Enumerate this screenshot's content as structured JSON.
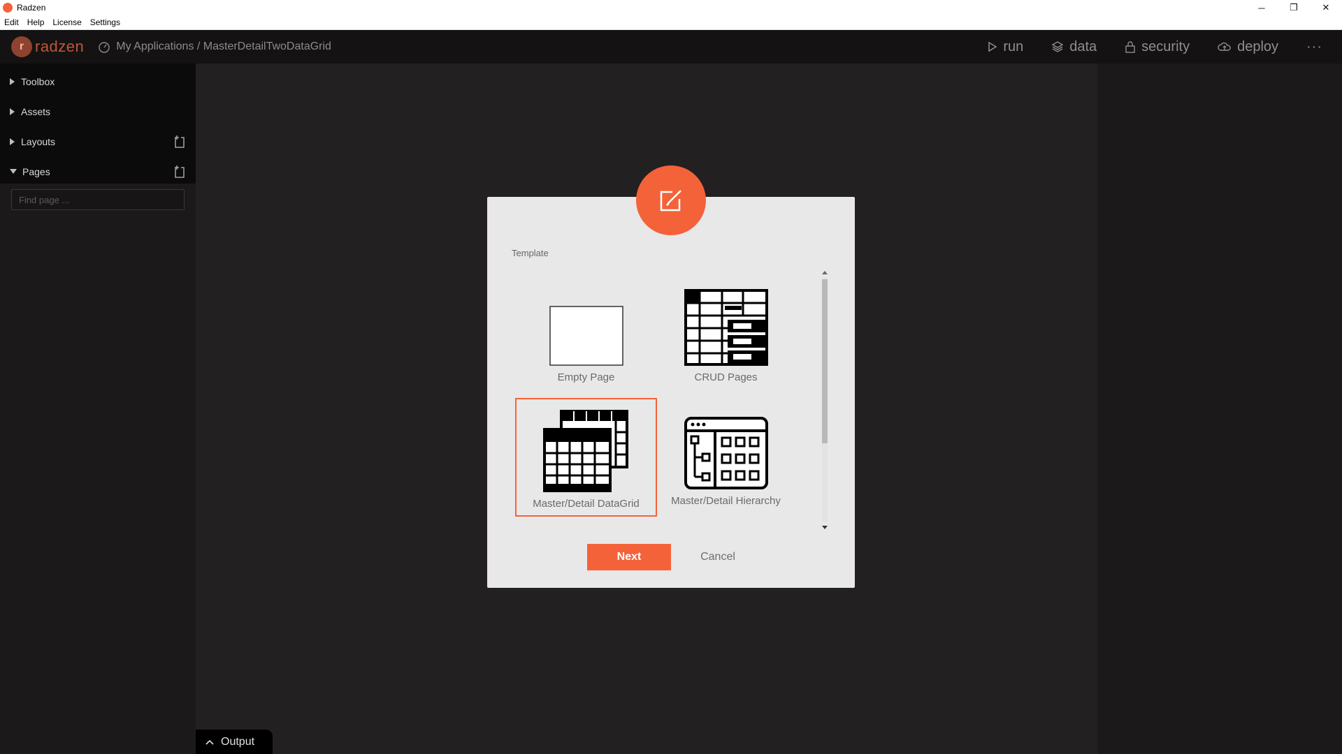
{
  "window": {
    "title": "Radzen",
    "controls": {
      "minimize": "─",
      "restore": "❐",
      "close": "✕"
    }
  },
  "menu": [
    "Edit",
    "Help",
    "License",
    "Settings"
  ],
  "header": {
    "logo_text": "radzen",
    "breadcrumb": "My Applications / MasterDetailTwoDataGrid",
    "nav": {
      "run": "run",
      "data": "data",
      "security": "security",
      "deploy": "deploy",
      "more": "···"
    }
  },
  "sidebar": {
    "items": [
      "Toolbox",
      "Assets",
      "Layouts",
      "Pages"
    ],
    "find_placeholder": "Find page ..."
  },
  "dialog": {
    "section_label": "Template",
    "templates": [
      "Empty Page",
      "CRUD Pages",
      "Master/Detail DataGrid",
      "Master/Detail Hierarchy"
    ],
    "selected": "Master/Detail DataGrid",
    "next_label": "Next",
    "cancel_label": "Cancel"
  },
  "output_tab": "Output",
  "colors": {
    "accent": "#f4623a",
    "header_bg": "#141212",
    "dialog_bg": "#e8e8e8"
  }
}
